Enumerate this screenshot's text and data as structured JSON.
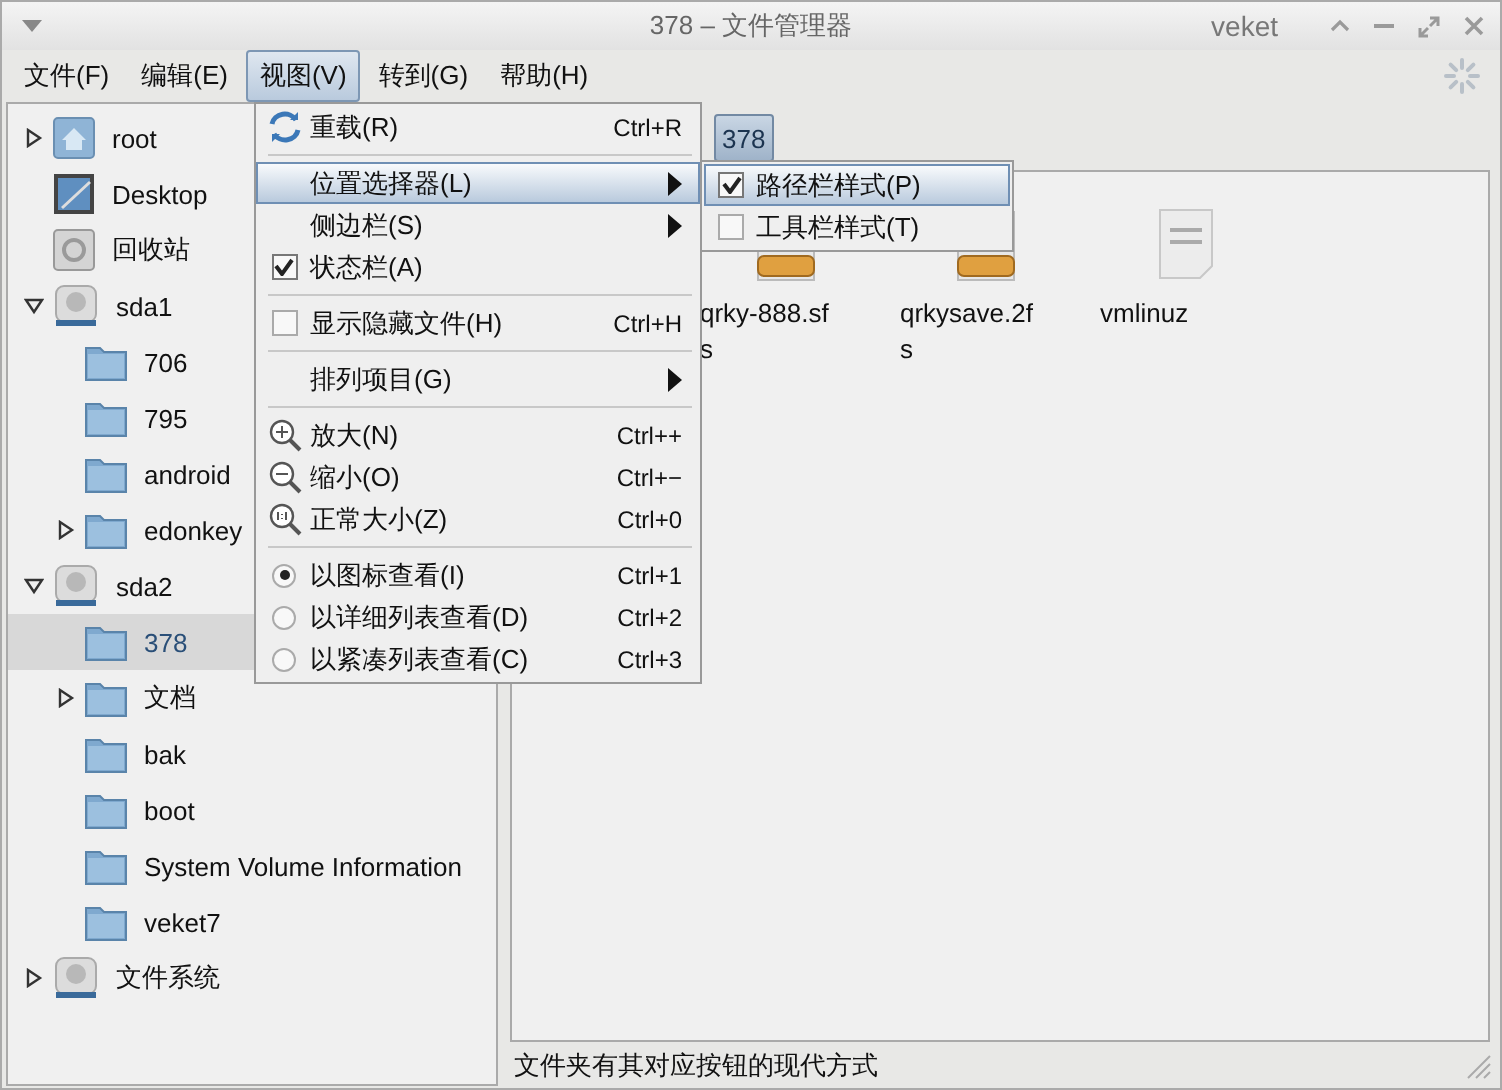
{
  "window": {
    "title": "378 – 文件管理器",
    "app_name": "veket"
  },
  "menubar": [
    {
      "label": "文件(F)",
      "selected": false
    },
    {
      "label": "编辑(E)",
      "selected": false
    },
    {
      "label": "视图(V)",
      "selected": true
    },
    {
      "label": "转到(G)",
      "selected": false
    },
    {
      "label": "帮助(H)",
      "selected": false
    }
  ],
  "sidebar": {
    "items": [
      {
        "label": "root",
        "kind": "home",
        "expanded": false,
        "selected": false
      },
      {
        "label": "Desktop",
        "kind": "desktop",
        "selected": false
      },
      {
        "label": "回收站",
        "kind": "trash",
        "selected": false
      },
      {
        "label": "sda1",
        "kind": "drive",
        "expanded": true,
        "selected": false,
        "children": [
          {
            "label": "706",
            "kind": "folder",
            "selected": false
          },
          {
            "label": "795",
            "kind": "folder",
            "selected": false
          },
          {
            "label": "android",
            "kind": "folder",
            "selected": false
          },
          {
            "label": "edonkey",
            "kind": "folder",
            "expanded": false,
            "selected": false
          }
        ]
      },
      {
        "label": "sda2",
        "kind": "drive",
        "expanded": true,
        "selected": false,
        "children": [
          {
            "label": "378",
            "kind": "folder",
            "selected": true
          },
          {
            "label": "文档",
            "kind": "folder",
            "expanded": false,
            "selected": false
          },
          {
            "label": "bak",
            "kind": "folder",
            "selected": false
          },
          {
            "label": "boot",
            "kind": "folder",
            "selected": false
          },
          {
            "label": "System Volume Information",
            "kind": "folder",
            "selected": false
          },
          {
            "label": "veket7",
            "kind": "folder",
            "selected": false
          }
        ]
      },
      {
        "label": "文件系统",
        "kind": "drive",
        "expanded": false,
        "selected": false
      }
    ]
  },
  "path_bar": {
    "buttons": [
      {
        "label": "378",
        "selected": true
      }
    ]
  },
  "files": [
    {
      "name": "qrky-888.sf\ns",
      "kind": "package"
    },
    {
      "name": "qrkysave.2f\ns",
      "kind": "package"
    },
    {
      "name": "vmlinuz",
      "kind": "binary"
    }
  ],
  "view_menu": [
    {
      "kind": "reload",
      "label": "重载(R)",
      "shortcut": "Ctrl+R"
    },
    {
      "kind": "separator"
    },
    {
      "kind": "submenu",
      "label": "位置选择器(L)",
      "selected": true
    },
    {
      "kind": "submenu",
      "label": "侧边栏(S)",
      "selected": false
    },
    {
      "kind": "check",
      "label": "状态栏(A)",
      "checked": true
    },
    {
      "kind": "separator"
    },
    {
      "kind": "check",
      "label": "显示隐藏文件(H)",
      "checked": false,
      "shortcut": "Ctrl+H"
    },
    {
      "kind": "separator"
    },
    {
      "kind": "submenu",
      "label": "排列项目(G)",
      "selected": false
    },
    {
      "kind": "separator"
    },
    {
      "kind": "zoom_in",
      "label": "放大(N)",
      "shortcut": "Ctrl++"
    },
    {
      "kind": "zoom_out",
      "label": "缩小(O)",
      "shortcut": "Ctrl+−"
    },
    {
      "kind": "zoom_normal",
      "label": "正常大小(Z)",
      "shortcut": "Ctrl+0"
    },
    {
      "kind": "separator"
    },
    {
      "kind": "radio",
      "label": "以图标查看(I)",
      "checked": true,
      "shortcut": "Ctrl+1"
    },
    {
      "kind": "radio",
      "label": "以详细列表查看(D)",
      "checked": false,
      "shortcut": "Ctrl+2"
    },
    {
      "kind": "radio",
      "label": "以紧凑列表查看(C)",
      "checked": false,
      "shortcut": "Ctrl+3"
    }
  ],
  "location_submenu": [
    {
      "label": "路径栏样式(P)",
      "checked": true,
      "selected": true
    },
    {
      "label": "工具栏样式(T)",
      "checked": false,
      "selected": false
    }
  ],
  "status_bar": "文件夹有其对应按钮的现代方式"
}
